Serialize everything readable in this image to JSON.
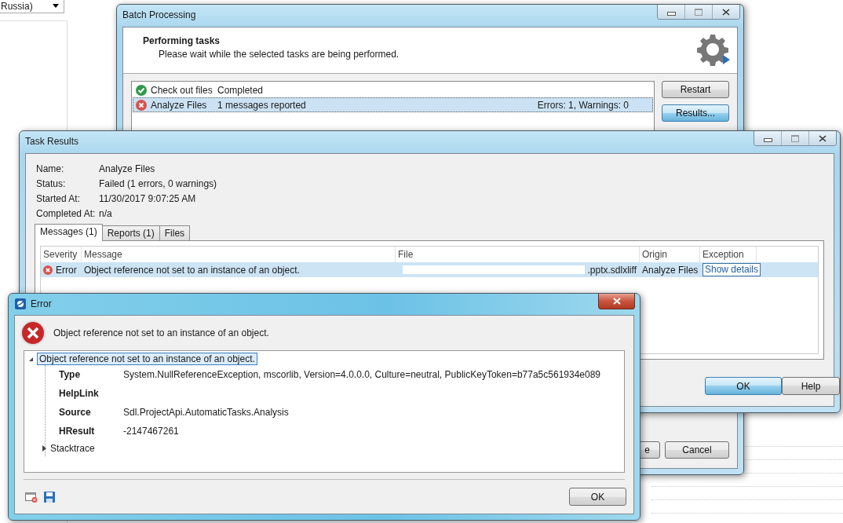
{
  "background_app": {
    "combo_value": "Russia)"
  },
  "batch_window": {
    "title": "Batch Processing",
    "header": {
      "title": "Performing tasks",
      "subtitle": "Please wait while the selected tasks are being performed."
    },
    "tasks": [
      {
        "name": "Check out files",
        "status": "Completed",
        "kind": "success",
        "selected": false
      },
      {
        "name": "Analyze Files",
        "status": "1 messages reported",
        "summary": "Errors: 1, Warnings: 0",
        "kind": "error",
        "selected": true
      }
    ],
    "side_buttons": [
      "Restart",
      "Results..."
    ],
    "footer_buttons": [
      "e",
      "Cancel"
    ]
  },
  "task_results": {
    "title": "Task Results",
    "fields": [
      {
        "label": "Name:",
        "value": "Analyze Files"
      },
      {
        "label": "Status:",
        "value": "Failed (1 errors, 0 warnings)"
      },
      {
        "label": "Started At:",
        "value": "11/30/2017 9:07:25 AM"
      },
      {
        "label": "Completed At:",
        "value": "n/a"
      }
    ],
    "tabs": [
      {
        "label": "Messages (1)",
        "selected": true
      },
      {
        "label": "Reports (1)",
        "selected": false
      },
      {
        "label": "Files",
        "selected": false
      }
    ],
    "table": {
      "columns": [
        "Severity",
        "Message",
        "File",
        "Origin",
        "Exception"
      ],
      "rows": [
        {
          "severity": "Error",
          "message": "Object reference not set to an instance of an object.",
          "file": ".pptx.sdlxliff",
          "origin": "Analyze Files",
          "exception": "Show details",
          "selected": true
        }
      ]
    },
    "buttons": [
      {
        "label": "OK",
        "default": true
      },
      {
        "label": "Help",
        "default": false
      }
    ]
  },
  "error_dialog": {
    "title": "Error",
    "message": "Object reference not set to an instance of an object.",
    "tree": {
      "label": "Object reference not set to an instance of an object.",
      "expanded": true,
      "selected": true,
      "properties": [
        {
          "name": "Type",
          "value": "System.NullReferenceException, mscorlib, Version=4.0.0.0, Culture=neutral, PublicKeyToken=b77a5c561934e089"
        },
        {
          "name": "HelpLink"
        },
        {
          "name": "Source",
          "value": "Sdl.ProjectApi.AutomaticTasks.Analysis"
        },
        {
          "name": "HResult",
          "value": "-2147467261"
        }
      ],
      "children": [
        {
          "label": "Stacktrace",
          "expanded": false
        }
      ]
    },
    "button": "OK"
  }
}
